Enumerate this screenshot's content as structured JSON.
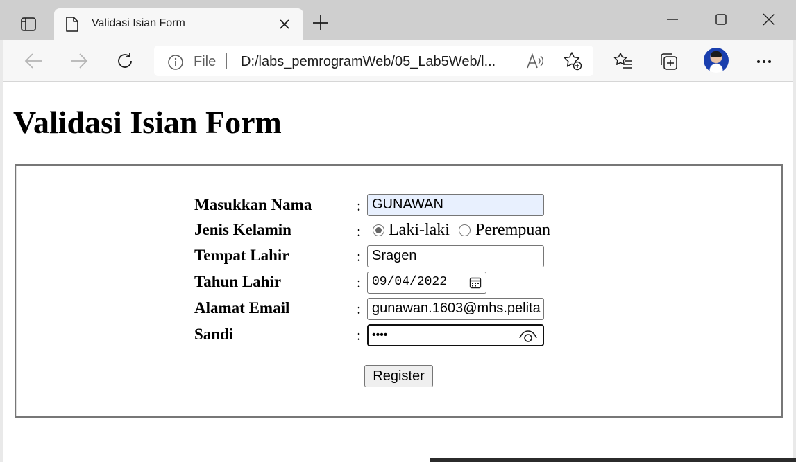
{
  "browser": {
    "tab": {
      "title": "Validasi Isian Form"
    },
    "address_bar": {
      "scheme": "File",
      "url": "D:/labs_pemrogramWeb/05_Lab5Web/l..."
    }
  },
  "page": {
    "heading": "Validasi Isian Form",
    "form": {
      "colon": ":",
      "name": {
        "label": "Masukkan Nama",
        "value": "GUNAWAN"
      },
      "gender": {
        "label": "Jenis Kelamin",
        "options": [
          "Laki-laki",
          "Perempuan"
        ],
        "selected": "Laki-laki"
      },
      "birthplace": {
        "label": "Tempat Lahir",
        "value": "Sragen"
      },
      "birthdate": {
        "label": "Tahun Lahir",
        "value": "09/04/2022"
      },
      "email": {
        "label": "Alamat Email",
        "value": "gunawan.1603@mhs.pelita"
      },
      "password": {
        "label": "Sandi",
        "value": "••••"
      },
      "submit_label": "Register"
    }
  }
}
